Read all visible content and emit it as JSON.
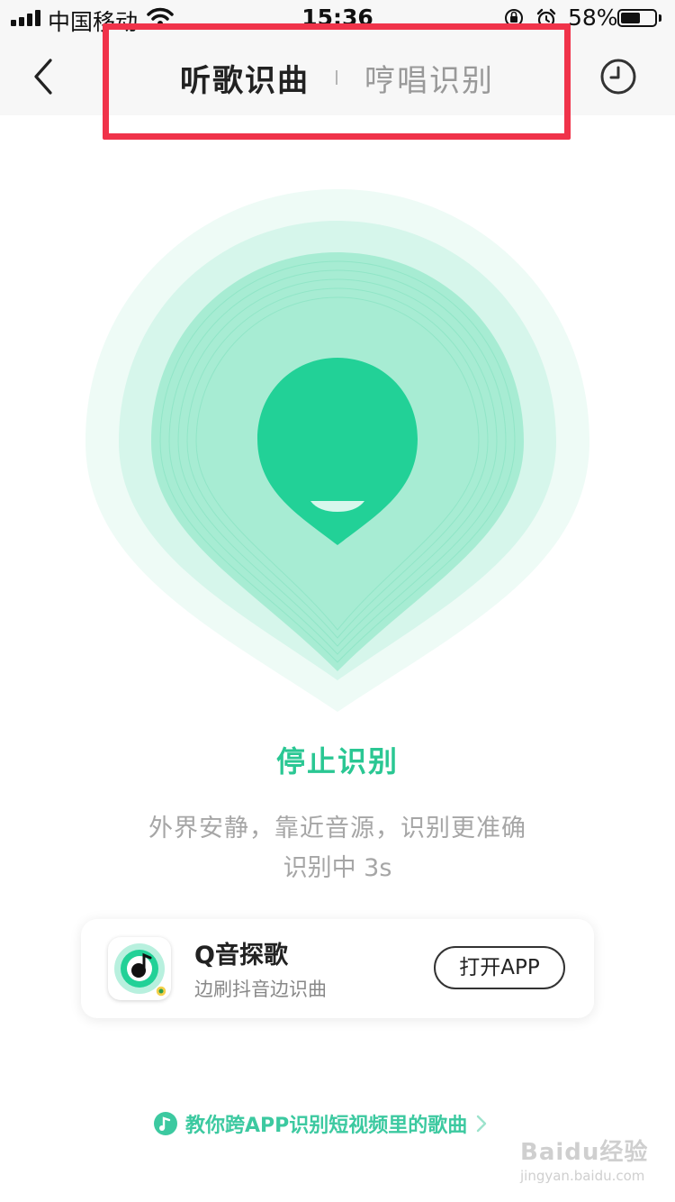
{
  "status_bar": {
    "carrier": "中国移动",
    "time": "15:36",
    "battery_percent": "58%",
    "battery_level": 0.58
  },
  "nav": {
    "tabs": [
      {
        "label": "听歌识曲",
        "active": true
      },
      {
        "label": "哼唱识别",
        "active": false
      }
    ],
    "back_icon": "chevron-left-icon",
    "history_icon": "clock-icon"
  },
  "recognizer": {
    "stop_label": "停止识别",
    "hint": "外界安静，靠近音源，识别更准确",
    "status": "识别中 3s",
    "accent_color": "#22d197"
  },
  "promo": {
    "app_name": "Q音探歌",
    "description": "边刷抖音边识曲",
    "button_label": "打开APP"
  },
  "footer": {
    "link_text": "教你跨APP识别短视频里的歌曲",
    "watermark": "Baidu经验",
    "watermark_url": "jingyan.baidu.com"
  }
}
